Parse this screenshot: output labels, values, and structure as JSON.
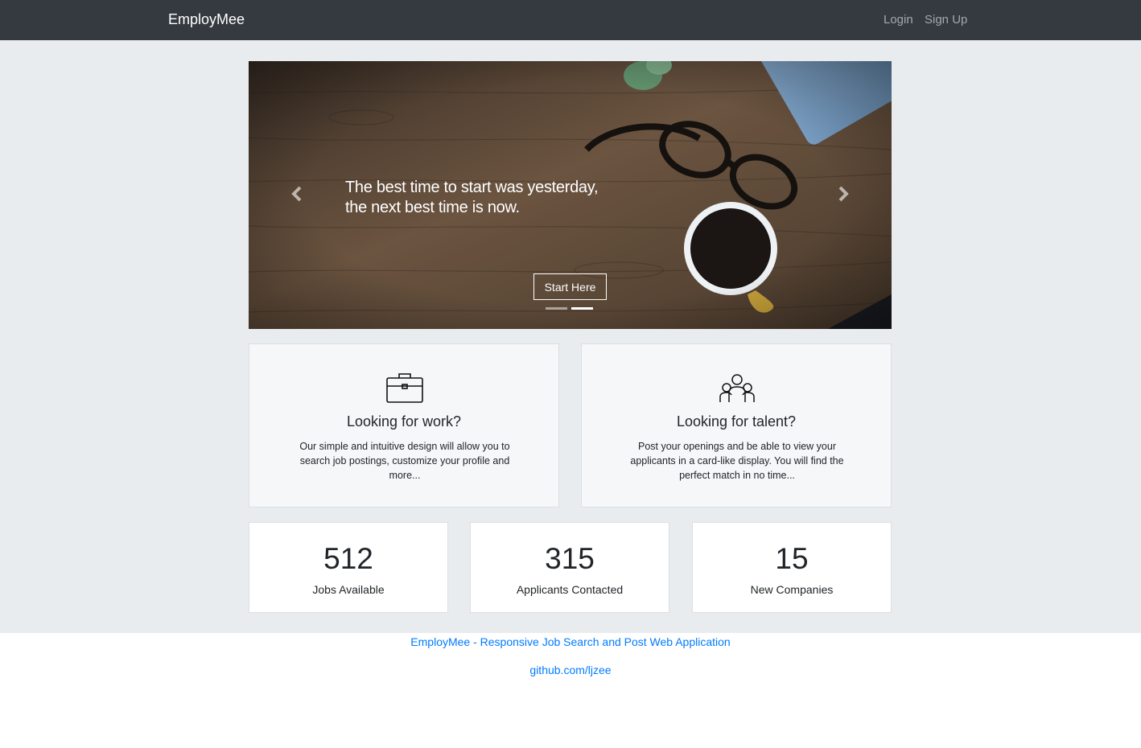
{
  "navbar": {
    "brand": "EmployMee",
    "login": "Login",
    "signup": "Sign Up"
  },
  "hero": {
    "caption_line1": "The best time to start was yesterday,",
    "caption_line2": "the next best time is now.",
    "cta": "Start Here",
    "prev_icon": "chevron-left-icon",
    "next_icon": "chevron-right-icon",
    "slide_count": 2,
    "active_slide": 2
  },
  "features": [
    {
      "icon": "briefcase-icon",
      "title": "Looking for work?",
      "text": "Our simple and intuitive design will allow you to search job postings, customize your profile and more..."
    },
    {
      "icon": "team-icon",
      "title": "Looking for talent?",
      "text": "Post your openings and be able to view your applicants in a card-like display. You will find the perfect match in no time..."
    }
  ],
  "stats": [
    {
      "value": "512",
      "label": "Jobs Available"
    },
    {
      "value": "315",
      "label": "Applicants Contacted"
    },
    {
      "value": "15",
      "label": "New Companies"
    }
  ],
  "footer": {
    "line1": "EmployMee - Responsive Job Search and Post Web Application",
    "line2": "github.com/ljzee"
  },
  "colors": {
    "navbar_bg": "#343a40",
    "page_bg": "#e9ecef",
    "link": "#007bff"
  }
}
